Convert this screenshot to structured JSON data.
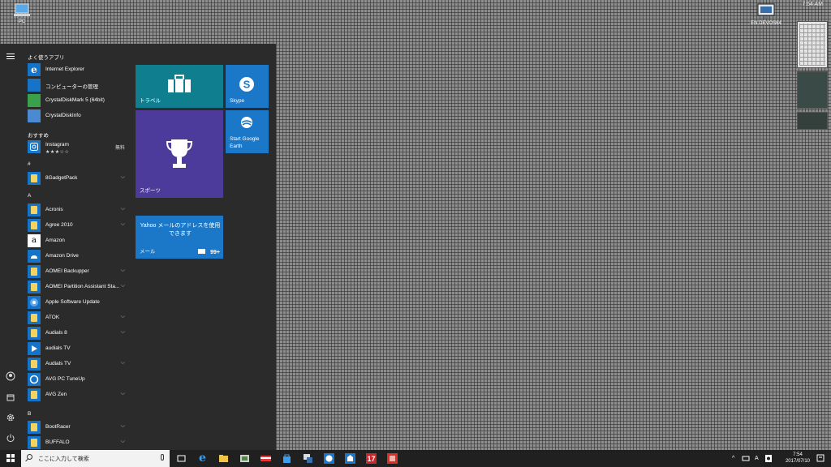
{
  "desktop": {
    "icon_top_left": "PC",
    "icon_top_right": "EN DEVOS64",
    "corner_time": "7:54 AM"
  },
  "start_menu": {
    "frequent_header": "よく使うアプリ",
    "frequent_apps": [
      {
        "label": "Internet Explorer",
        "icon": "ie-icon"
      },
      {
        "label": "コンピューターの管理",
        "icon": "computer-management-icon"
      },
      {
        "label": "CrystalDiskMark 5 (64bit)",
        "icon": "crystaldiskmark-icon"
      },
      {
        "label": "CrystalDiskInfo",
        "icon": "crystaldiskinfo-icon"
      }
    ],
    "recommended_header": "おすすめ",
    "recommended_app": {
      "label": "Instagram",
      "rating": "★★★☆☆",
      "price": "無料"
    },
    "sections": [
      {
        "letter": "#",
        "apps": [
          {
            "label": "8GadgetPack",
            "expandable": true
          }
        ]
      },
      {
        "letter": "A",
        "apps": [
          {
            "label": "Acronis",
            "expandable": true
          },
          {
            "label": "Agree 2010",
            "expandable": true
          },
          {
            "label": "Amazon",
            "expandable": false
          },
          {
            "label": "Amazon Drive",
            "expandable": false
          },
          {
            "label": "AOMEI Backupper",
            "expandable": true
          },
          {
            "label": "AOMEI Partition Assistant Sta...",
            "expandable": true
          },
          {
            "label": "Apple Software Update",
            "expandable": false
          },
          {
            "label": "ATOK",
            "expandable": true
          },
          {
            "label": "Audials 8",
            "expandable": true
          },
          {
            "label": "audials TV",
            "expandable": false
          },
          {
            "label": "Audials TV",
            "expandable": true
          },
          {
            "label": "AVG PC TuneUp",
            "expandable": false
          },
          {
            "label": "AVG Zen",
            "expandable": true
          }
        ]
      },
      {
        "letter": "B",
        "apps": [
          {
            "label": "BootRacer",
            "expandable": true
          },
          {
            "label": "BUFFALO",
            "expandable": true
          }
        ]
      }
    ],
    "tiles": {
      "travel": {
        "label": "トラベル",
        "color": "#0f7f8f"
      },
      "skype": {
        "label": "Skype",
        "color": "#1b78c8"
      },
      "sports": {
        "label": "スポーツ",
        "color": "#4d3b9c"
      },
      "google_earth": {
        "label_line1": "Start Google",
        "label_line2": "Earth",
        "color": "#1b78c8"
      },
      "mail": {
        "label": "メール",
        "message": "Yahoo メールのアドレスを使用できます",
        "badge": "99+",
        "color": "#1b78c8"
      }
    }
  },
  "taskbar": {
    "search_placeholder": "ここに入力して検索",
    "clock_time": "7:54",
    "clock_date": "2017/07/10",
    "tray_ime": "A"
  },
  "colors": {
    "start_bg": "#2b2b2b",
    "taskbar_bg": "#202020",
    "accent": "#1b78c8"
  }
}
